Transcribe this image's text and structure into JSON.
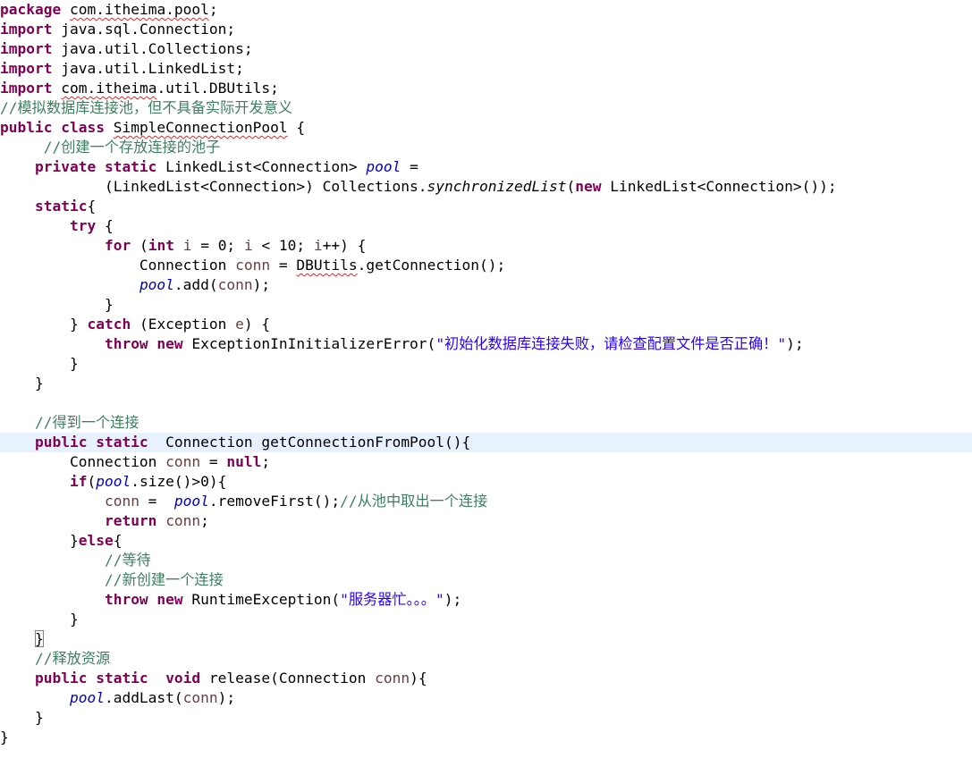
{
  "editor": {
    "current_line": 22,
    "colors": {
      "keyword": "#7f0055",
      "comment": "#3f7f5f",
      "string": "#2a00ff",
      "field": "#0000c0",
      "local_variable": "#6a3e3e",
      "current_line_highlight": "#e8f2fe",
      "error_underline": "#d03030"
    },
    "lines": [
      [
        [
          "kw",
          "package"
        ],
        [
          "pl",
          " "
        ],
        [
          "sq",
          "com.itheima.pool"
        ],
        [
          "pl",
          ";"
        ]
      ],
      [
        [
          "kw",
          "import"
        ],
        [
          "pl",
          " java.sql.Connection;"
        ]
      ],
      [
        [
          "kw",
          "import"
        ],
        [
          "pl",
          " java.util.Collections;"
        ]
      ],
      [
        [
          "kw",
          "import"
        ],
        [
          "pl",
          " java.util.LinkedList;"
        ]
      ],
      [
        [
          "kw",
          "import"
        ],
        [
          "pl",
          " "
        ],
        [
          "sq",
          "com.itheima"
        ],
        [
          "pl",
          ".util.DBUtils;"
        ]
      ],
      [
        [
          "cm",
          "//模拟数据库连接池，但不具备实际开发意义"
        ]
      ],
      [
        [
          "kw",
          "public class"
        ],
        [
          "pl",
          " "
        ],
        [
          "sq",
          "SimpleConnectionPool"
        ],
        [
          "pl",
          " {"
        ]
      ],
      [
        [
          "pl",
          "     "
        ],
        [
          "cm",
          "//创建一个存放连接的池子"
        ]
      ],
      [
        [
          "pl",
          "    "
        ],
        [
          "kw",
          "private static"
        ],
        [
          "pl",
          " LinkedList<Connection> "
        ],
        [
          "fld",
          "pool"
        ],
        [
          "pl",
          " ="
        ]
      ],
      [
        [
          "pl",
          "            (LinkedList<Connection>) Collections."
        ],
        [
          "mth",
          "synchronizedList"
        ],
        [
          "pl",
          "("
        ],
        [
          "kw",
          "new"
        ],
        [
          "pl",
          " LinkedList<Connection>());"
        ]
      ],
      [
        [
          "pl",
          "    "
        ],
        [
          "kw",
          "static"
        ],
        [
          "pl",
          "{"
        ]
      ],
      [
        [
          "pl",
          "        "
        ],
        [
          "kw",
          "try"
        ],
        [
          "pl",
          " {"
        ]
      ],
      [
        [
          "pl",
          "            "
        ],
        [
          "kw",
          "for"
        ],
        [
          "pl",
          " ("
        ],
        [
          "kw",
          "int"
        ],
        [
          "pl",
          " "
        ],
        [
          "var",
          "i"
        ],
        [
          "pl",
          " = 0; "
        ],
        [
          "var",
          "i"
        ],
        [
          "pl",
          " < 10; "
        ],
        [
          "var",
          "i"
        ],
        [
          "pl",
          "++) {"
        ]
      ],
      [
        [
          "pl",
          "                Connection "
        ],
        [
          "var",
          "conn"
        ],
        [
          "pl",
          " = "
        ],
        [
          "sq",
          "DBUtils"
        ],
        [
          "pl",
          ".getConnection();"
        ]
      ],
      [
        [
          "pl",
          "                "
        ],
        [
          "fld",
          "pool"
        ],
        [
          "pl",
          ".add("
        ],
        [
          "var",
          "conn"
        ],
        [
          "pl",
          ");"
        ]
      ],
      [
        [
          "pl",
          "            }"
        ]
      ],
      [
        [
          "pl",
          "        } "
        ],
        [
          "kw",
          "catch"
        ],
        [
          "pl",
          " (Exception "
        ],
        [
          "var",
          "e"
        ],
        [
          "pl",
          ") {"
        ]
      ],
      [
        [
          "pl",
          "            "
        ],
        [
          "kw",
          "throw new"
        ],
        [
          "pl",
          " ExceptionInInitializerError("
        ],
        [
          "st",
          "\"初始化数据库连接失败，请检查配置文件是否正确！\""
        ],
        [
          "pl",
          ");"
        ]
      ],
      [
        [
          "pl",
          "        }"
        ]
      ],
      [
        [
          "pl",
          "    }"
        ]
      ],
      [
        [
          "pl",
          " "
        ]
      ],
      [
        [
          "pl",
          "    "
        ],
        [
          "cm",
          "//得到一个连接"
        ]
      ],
      [
        [
          "pl",
          "    "
        ],
        [
          "kw",
          "public static"
        ],
        [
          "pl",
          "  Connection getConnectionFromPool(){"
        ]
      ],
      [
        [
          "pl",
          "        Connection "
        ],
        [
          "var",
          "conn"
        ],
        [
          "pl",
          " = "
        ],
        [
          "kw",
          "null"
        ],
        [
          "pl",
          ";"
        ]
      ],
      [
        [
          "pl",
          "        "
        ],
        [
          "kw",
          "if"
        ],
        [
          "pl",
          "("
        ],
        [
          "fld",
          "pool"
        ],
        [
          "pl",
          ".size()>0){"
        ]
      ],
      [
        [
          "pl",
          "            "
        ],
        [
          "var",
          "conn"
        ],
        [
          "pl",
          " =  "
        ],
        [
          "fld",
          "pool"
        ],
        [
          "pl",
          ".removeFirst();"
        ],
        [
          "cm",
          "//从池中取出一个连接"
        ]
      ],
      [
        [
          "pl",
          "            "
        ],
        [
          "kw",
          "return"
        ],
        [
          "pl",
          " "
        ],
        [
          "var",
          "conn"
        ],
        [
          "pl",
          ";"
        ]
      ],
      [
        [
          "pl",
          "        }"
        ],
        [
          "kw",
          "else"
        ],
        [
          "pl",
          "{"
        ]
      ],
      [
        [
          "pl",
          "            "
        ],
        [
          "cm",
          "//等待"
        ]
      ],
      [
        [
          "pl",
          "            "
        ],
        [
          "cm",
          "//新创建一个连接"
        ]
      ],
      [
        [
          "pl",
          "            "
        ],
        [
          "kw",
          "throw new"
        ],
        [
          "pl",
          " RuntimeException("
        ],
        [
          "st",
          "\"服务器忙。。。\""
        ],
        [
          "pl",
          ");"
        ]
      ],
      [
        [
          "pl",
          "        }"
        ]
      ],
      [
        [
          "pl",
          "    "
        ],
        [
          "br",
          "}"
        ]
      ],
      [
        [
          "pl",
          "    "
        ],
        [
          "cm",
          "//释放资源"
        ]
      ],
      [
        [
          "pl",
          "    "
        ],
        [
          "kw",
          "public static"
        ],
        [
          "pl",
          "  "
        ],
        [
          "kw",
          "void"
        ],
        [
          "pl",
          " release(Connection "
        ],
        [
          "var",
          "conn"
        ],
        [
          "pl",
          "){"
        ]
      ],
      [
        [
          "pl",
          "        "
        ],
        [
          "fld",
          "pool"
        ],
        [
          "pl",
          ".addLast("
        ],
        [
          "var",
          "conn"
        ],
        [
          "pl",
          ");"
        ]
      ],
      [
        [
          "pl",
          "    }"
        ]
      ],
      [
        [
          "pl",
          "}"
        ]
      ]
    ]
  }
}
